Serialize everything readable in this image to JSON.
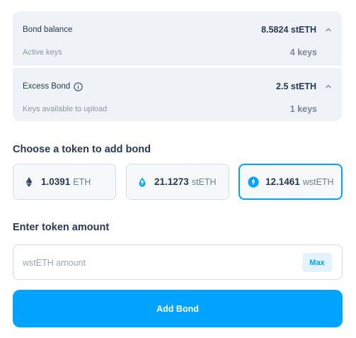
{
  "bond": {
    "balance_label": "Bond balance",
    "balance_value": "8.5824 stETH",
    "active_keys_label": "Active keys",
    "active_keys_value": "4 keys",
    "excess_label": "Excess Bond",
    "excess_value": "2.5 stETH",
    "keys_available_label": "Keys available to upload",
    "keys_available_value": "1 keys"
  },
  "token_select": {
    "heading": "Choose a token to add bond",
    "selected": "wstETH",
    "options": [
      {
        "amount": "1.0391",
        "symbol": "ETH",
        "icon": "eth-icon"
      },
      {
        "amount": "21.1273",
        "symbol": "stETH",
        "icon": "steth-icon"
      },
      {
        "amount": "12.1461",
        "symbol": "wstETH",
        "icon": "wsteth-icon"
      }
    ]
  },
  "amount": {
    "heading": "Enter token amount",
    "placeholder": "wstETH amount",
    "value": "",
    "max_label": "Max"
  },
  "submit": {
    "label": "Add Bond"
  },
  "colors": {
    "accent": "#00a3ff",
    "card_bg": "#eff2f6",
    "text_primary": "#273852",
    "text_secondary": "#8b97a7"
  }
}
